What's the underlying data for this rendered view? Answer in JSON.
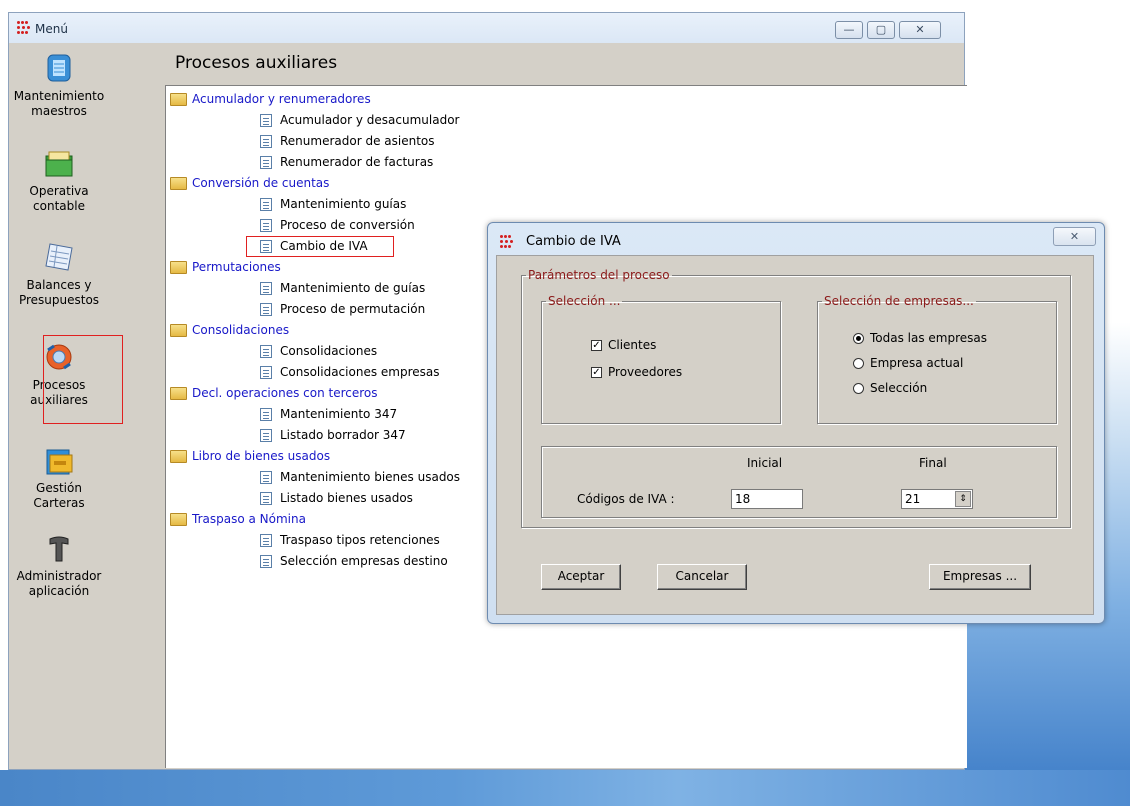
{
  "main_window": {
    "title": "Menú",
    "minimize_glyph": "—",
    "maximize_glyph": "▢",
    "close_glyph": "✕"
  },
  "nav": [
    {
      "label_1": "Mantenimiento",
      "label_2": "maestros",
      "icon": "database-icon"
    },
    {
      "label_1": "Operativa",
      "label_2": "contable",
      "icon": "folders-icon"
    },
    {
      "label_1": "Balances y",
      "label_2": "Presupuestos",
      "icon": "spreadsheet-icon"
    },
    {
      "label_1": "Procesos",
      "label_2": "auxiliares",
      "icon": "gears-icon"
    },
    {
      "label_1": "Gestión",
      "label_2": "Carteras",
      "icon": "folder-icon"
    },
    {
      "label_1": "Administrador",
      "label_2": "aplicación",
      "icon": "hammer-icon"
    }
  ],
  "section_title": "Procesos auxiliares",
  "tree": [
    {
      "label": "Acumulador y renumeradores",
      "folder": true
    },
    {
      "label": "Acumulador y desacumulador",
      "folder": false
    },
    {
      "label": "Renumerador de asientos",
      "folder": false
    },
    {
      "label": "Renumerador de facturas",
      "folder": false
    },
    {
      "label": "Conversión de cuentas",
      "folder": true
    },
    {
      "label": "Mantenimiento guías",
      "folder": false
    },
    {
      "label": "Proceso de conversión",
      "folder": false
    },
    {
      "label": "Cambio de IVA",
      "folder": false
    },
    {
      "label": "Permutaciones",
      "folder": true
    },
    {
      "label": "Mantenimiento de guías",
      "folder": false
    },
    {
      "label": "Proceso de permutación",
      "folder": false
    },
    {
      "label": "Consolidaciones",
      "folder": true
    },
    {
      "label": "Consolidaciones",
      "folder": false
    },
    {
      "label": "Consolidaciones empresas",
      "folder": false
    },
    {
      "label": "Decl. operaciones con terceros",
      "folder": true
    },
    {
      "label": "Mantenimiento 347",
      "folder": false
    },
    {
      "label": "Listado borrador 347",
      "folder": false
    },
    {
      "label": "Libro de bienes usados",
      "folder": true
    },
    {
      "label": "Mantenimiento bienes usados",
      "folder": false
    },
    {
      "label": "Listado bienes usados",
      "folder": false
    },
    {
      "label": "Traspaso a Nómina",
      "folder": true
    },
    {
      "label": "Traspaso tipos retenciones",
      "folder": false
    },
    {
      "label": "Selección empresas destino",
      "folder": false
    }
  ],
  "dialog": {
    "title": "Cambio de IVA",
    "close_glyph": "✕",
    "params_legend": "Parámetros del proceso",
    "selection_legend": "Selección ...",
    "checkboxes": [
      {
        "label": "Clientes",
        "checked": true
      },
      {
        "label": "Proveedores",
        "checked": true
      }
    ],
    "companies_legend": "Selección de empresas...",
    "radios": [
      {
        "label": "Todas las empresas",
        "selected": true
      },
      {
        "label": "Empresa actual",
        "selected": false
      },
      {
        "label": "Selección",
        "selected": false
      }
    ],
    "codes": {
      "inicial_header": "Inicial",
      "final_header": "Final",
      "label": "Códigos de IVA :",
      "inicial_value": "18",
      "final_value": "21"
    },
    "buttons": {
      "accept": "Aceptar",
      "cancel": "Cancelar",
      "companies": "Empresas ..."
    }
  }
}
